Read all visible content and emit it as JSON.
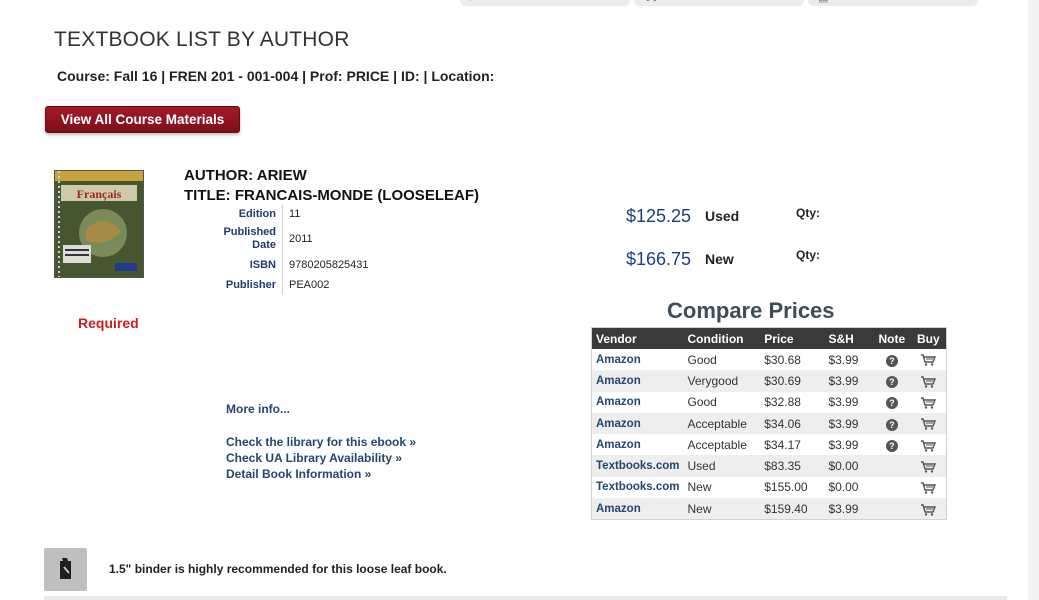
{
  "page": {
    "title": "TEXTBOOK LIST BY AUTHOR",
    "course_line": "Course: Fall 16 | FREN 201 - 001-004 | Prof: PRICE | ID: | Location:"
  },
  "view_all_button": {
    "label": "View All Course Materials"
  },
  "book": {
    "author_line": "AUTHOR: ARIEW",
    "title_line": "TITLE: FRANCAIS-MONDE (LOOSELEAF)",
    "details": {
      "edition_label": "Edition",
      "edition": "11",
      "published_label": "Published Date",
      "published": "2011",
      "isbn_label": "ISBN",
      "isbn": "9780205825431",
      "publisher_label": "Publisher",
      "publisher": "PEA002"
    },
    "status": "Required"
  },
  "pricing": {
    "used_price": "$125.25",
    "used_label": "Used",
    "new_price": "$166.75",
    "new_label": "New",
    "qty_label": "Qty:"
  },
  "links": {
    "more_info": "More info...",
    "library_ebook": "Check the library for this ebook »",
    "ua_library": "Check UA Library Availability »",
    "detail_info": "Detail Book Information »"
  },
  "compare": {
    "title": "Compare Prices",
    "headers": [
      "Vendor",
      "Condition",
      "Price",
      "S&H",
      "Note",
      "Buy"
    ],
    "rows": [
      {
        "vendor": "Amazon",
        "condition": "Good",
        "price": "$30.68",
        "sh": "$3.99",
        "note": true
      },
      {
        "vendor": "Amazon",
        "condition": "Verygood",
        "price": "$30.69",
        "sh": "$3.99",
        "note": true
      },
      {
        "vendor": "Amazon",
        "condition": "Good",
        "price": "$32.88",
        "sh": "$3.99",
        "note": true
      },
      {
        "vendor": "Amazon",
        "condition": "Acceptable",
        "price": "$34.06",
        "sh": "$3.99",
        "note": true
      },
      {
        "vendor": "Amazon",
        "condition": "Acceptable",
        "price": "$34.17",
        "sh": "$3.99",
        "note": true
      },
      {
        "vendor": "Textbooks.com",
        "condition": "Used",
        "price": "$83.35",
        "sh": "$0.00",
        "note": false
      },
      {
        "vendor": "Textbooks.com",
        "condition": "New",
        "price": "$155.00",
        "sh": "$0.00",
        "note": false
      },
      {
        "vendor": "Amazon",
        "condition": "New",
        "price": "$159.40",
        "sh": "$3.99",
        "note": false
      }
    ]
  },
  "note": {
    "text": "1.5\" binder is highly recommended for this loose leaf book."
  },
  "icons": {
    "top_tab_1": "search-icon",
    "top_tab_2": "cart-icon",
    "top_tab_3": "document-icon",
    "note_icon": "question-circle-icon",
    "buy_icon": "shopping-cart-icon",
    "note_badge": "binder-clip-icon"
  },
  "colors": {
    "button": "#8d1322",
    "required": "#cc1d1d",
    "price": "#1f3b8a",
    "link": "#25466f",
    "table_header": "#3a3a3a"
  }
}
